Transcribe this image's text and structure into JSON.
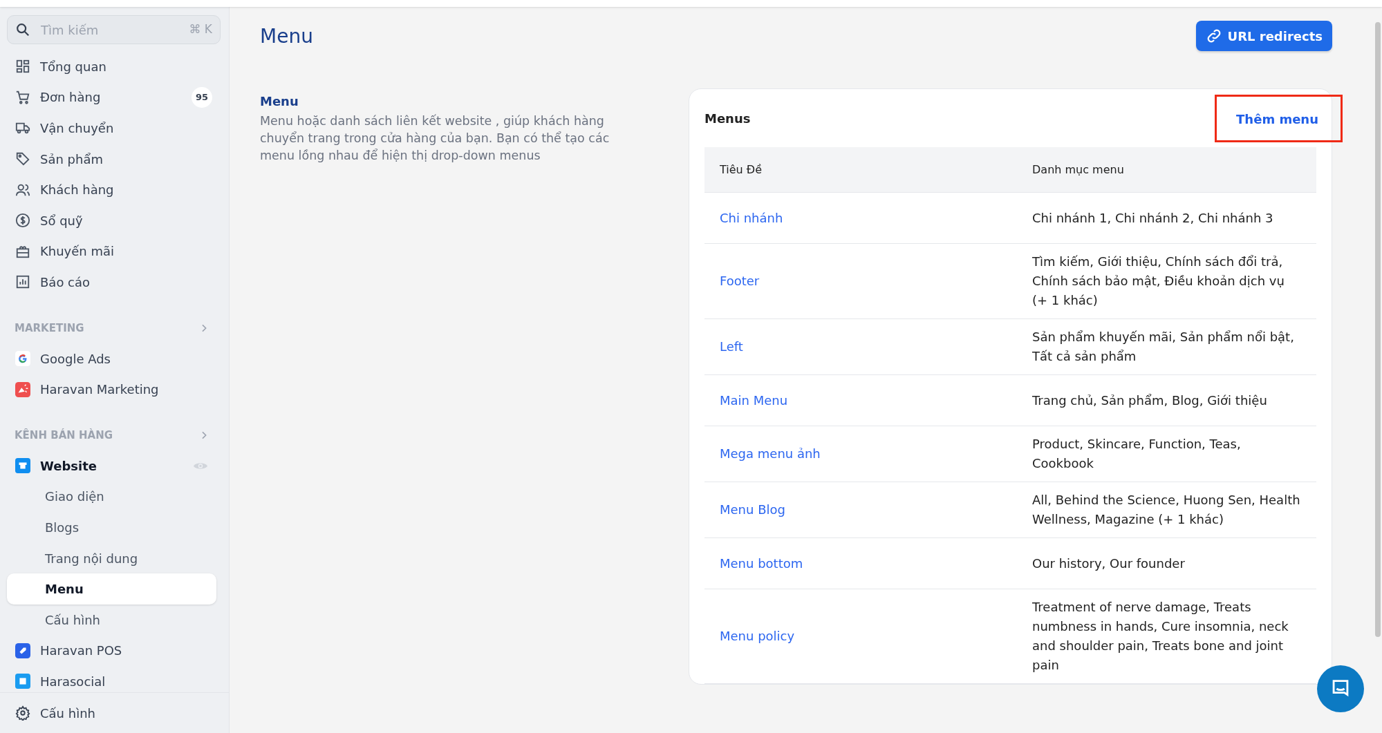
{
  "search": {
    "placeholder": "Tìm kiếm",
    "shortcut": "⌘ K"
  },
  "nav": [
    {
      "label": "Tổng quan",
      "kind": "grid"
    },
    {
      "label": "Đơn hàng",
      "kind": "cart",
      "badge": "95"
    },
    {
      "label": "Vận chuyển",
      "kind": "truck"
    },
    {
      "label": "Sản phẩm",
      "kind": "tag"
    },
    {
      "label": "Khách hàng",
      "kind": "users"
    },
    {
      "label": "Sổ quỹ",
      "kind": "dollar"
    },
    {
      "label": "Khuyến mãi",
      "kind": "gift"
    },
    {
      "label": "Báo cáo",
      "kind": "chart"
    }
  ],
  "sections": [
    {
      "title": "MARKETING",
      "items": [
        {
          "label": "Google Ads",
          "kind": "google",
          "selected": false
        },
        {
          "label": "Haravan Marketing",
          "kind": "megaphone",
          "selected": false
        }
      ]
    },
    {
      "title": "KÊNH BÁN HÀNG",
      "items": [
        {
          "label": "Website",
          "kind": "store",
          "selected": true,
          "children": [
            {
              "label": "Giao diện",
              "selected": false
            },
            {
              "label": "Blogs",
              "selected": false
            },
            {
              "label": "Trang nội dung",
              "selected": false
            },
            {
              "label": "Menu",
              "selected": true
            },
            {
              "label": "Cấu hình",
              "selected": false
            }
          ]
        },
        {
          "label": "Haravan POS",
          "kind": "pos",
          "selected": false
        },
        {
          "label": "Harasocial",
          "kind": "social",
          "selected": false
        }
      ]
    }
  ],
  "settings": {
    "label": "Cấu hình"
  },
  "page": {
    "title": "Menu",
    "button": "URL redirects"
  },
  "intro": {
    "title": "Menu",
    "text": "Menu hoặc danh sách liên kết website , giúp khách hàng chuyển trang trong cửa hàng của bạn. Bạn có thể tạo các menu lồng nhau để hiện thị drop-down menus"
  },
  "card": {
    "title": "Menus",
    "action": "Thêm menu",
    "action_highlighted": true
  },
  "table": {
    "columns": [
      "Tiêu Đề",
      "Danh mục menu"
    ],
    "rows": [
      [
        "Chi nhánh",
        "Chi nhánh 1, Chi nhánh 2, Chi nhánh 3"
      ],
      [
        "Footer",
        "Tìm kiếm, Giới thiệu, Chính sách đổi trả, Chính sách bảo mật, Điều khoản dịch vụ (+ 1 khác)"
      ],
      [
        "Left",
        "Sản phẩm khuyến mãi, Sản phẩm nổi bật, Tất cả sản phẩm"
      ],
      [
        "Main Menu",
        "Trang chủ, Sản phẩm, Blog, Giới thiệu"
      ],
      [
        "Mega menu ảnh",
        "Product, Skincare, Function, Teas, Cookbook"
      ],
      [
        "Menu Blog",
        "All, Behind the Science, Huong Sen, Health Wellness, Magazine (+ 1 khác)"
      ],
      [
        "Menu bottom",
        "Our history, Our founder"
      ],
      [
        "Menu policy",
        "Treatment of nerve damage, Treats numbness in hands, Cure insomnia, neck and shoulder pain, Treats bone and joint pain"
      ]
    ]
  }
}
